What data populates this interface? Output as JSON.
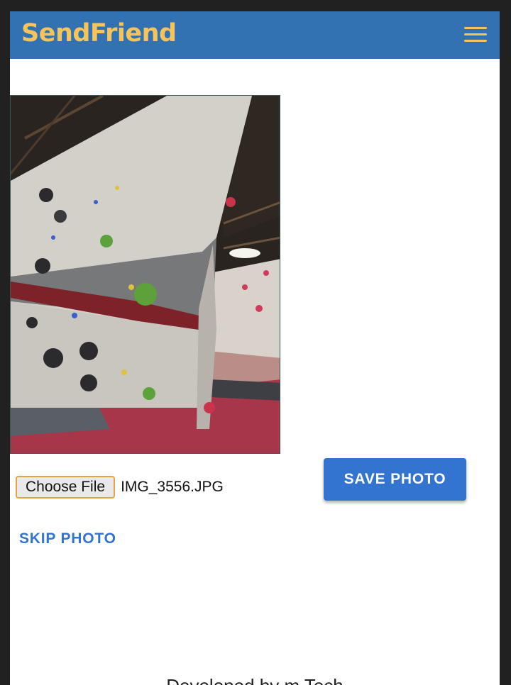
{
  "app": {
    "brand": "SendFriend",
    "menu_icon": "hamburger-menu-icon"
  },
  "colors": {
    "appbar": "#3272b3",
    "brand": "#f5c45a",
    "primary_button": "#3274cf",
    "file_button_border": "#e0a542"
  },
  "photo": {
    "subject": "indoor climbing wall"
  },
  "upload": {
    "choose_label": "Choose File",
    "file_name": "IMG_3556.JPG"
  },
  "actions": {
    "save_label": "SAVE PHOTO",
    "skip_label": "SKIP PHOTO"
  },
  "footer": {
    "text": "Developed by m Tech"
  }
}
